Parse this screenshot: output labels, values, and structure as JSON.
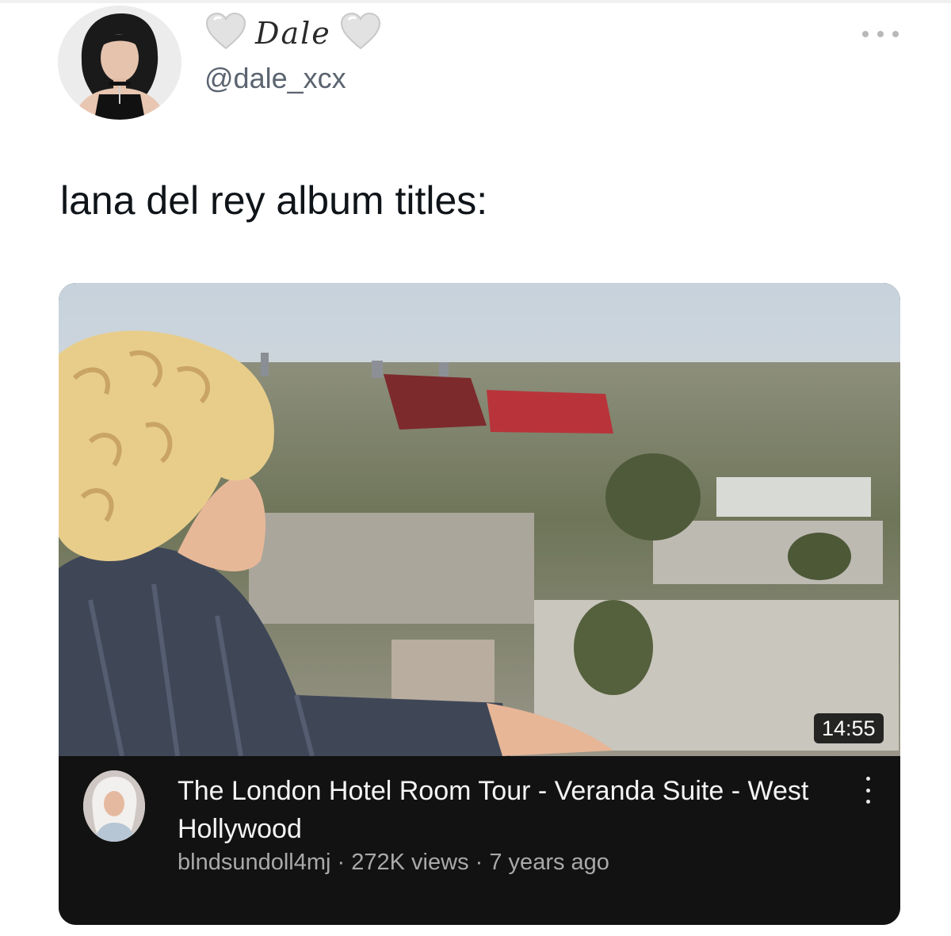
{
  "tweet": {
    "display_name": "Dale",
    "name_decoration_icon": "heart-icon",
    "handle": "@dale_xcx",
    "text": "lana del rey album titles:",
    "more_icon": "more-horizontal-icon"
  },
  "video_card": {
    "title": "The London Hotel Room Tour - Veranda Suite - West Hollywood",
    "channel": "blndsundoll4mj",
    "separator": "·",
    "views": "272K views",
    "age": "7 years ago",
    "duration": "14:55",
    "menu_icon": "more-vertical-icon"
  },
  "colors": {
    "card_background": "#121212",
    "handle": "#5b6470",
    "meta_text": "#a9a9a9",
    "title_text": "#f4f4f4"
  }
}
